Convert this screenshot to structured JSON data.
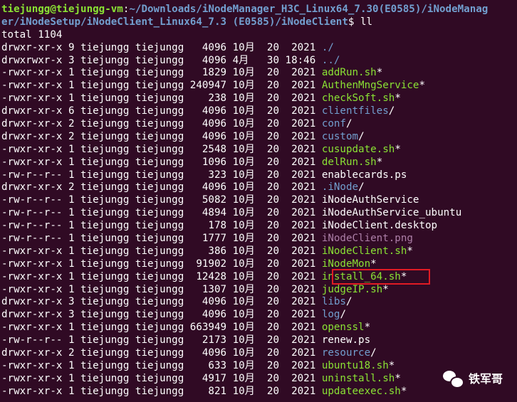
{
  "prompt": {
    "user_host": "tiejungg@tiejungg-vm",
    "separator": ":",
    "path_line1": "~/Downloads/iNodeManager_H3C_Linux64_7.30(E0585)/iNodeManag",
    "path_line2": "er/iNodeSetup/iNodeClient_Linux64_7.3 (E0585)/iNodeClient",
    "symbol": "$ ",
    "command": "ll"
  },
  "total": "total 1104",
  "entries": [
    {
      "meta": "drwxr-xr-x 9 tiejungg tiejungg   4096 10月  20  2021 ",
      "name": "./",
      "cls": "dir",
      "suffix": ""
    },
    {
      "meta": "drwxrwxr-x 3 tiejungg tiejungg   4096 4月   30 18:46 ",
      "name": "../",
      "cls": "dir",
      "suffix": ""
    },
    {
      "meta": "-rwxr-xr-x 1 tiejungg tiejungg   1829 10月  20  2021 ",
      "name": "addRun.sh",
      "cls": "exe",
      "suffix": "*"
    },
    {
      "meta": "-rwxr-xr-x 1 tiejungg tiejungg 240947 10月  20  2021 ",
      "name": "AuthenMngService",
      "cls": "exe",
      "suffix": "*"
    },
    {
      "meta": "-rwxr-xr-x 1 tiejungg tiejungg    238 10月  20  2021 ",
      "name": "checkSoft.sh",
      "cls": "exe",
      "suffix": "*"
    },
    {
      "meta": "drwxr-xr-x 6 tiejungg tiejungg   4096 10月  20  2021 ",
      "name": "clientfiles",
      "cls": "dir",
      "suffix": "/"
    },
    {
      "meta": "drwxr-xr-x 2 tiejungg tiejungg   4096 10月  20  2021 ",
      "name": "conf",
      "cls": "dir",
      "suffix": "/"
    },
    {
      "meta": "drwxr-xr-x 2 tiejungg tiejungg   4096 10月  20  2021 ",
      "name": "custom",
      "cls": "dir",
      "suffix": "/"
    },
    {
      "meta": "-rwxr-xr-x 1 tiejungg tiejungg   2548 10月  20  2021 ",
      "name": "cusupdate.sh",
      "cls": "exe",
      "suffix": "*"
    },
    {
      "meta": "-rwxr-xr-x 1 tiejungg tiejungg   1096 10月  20  2021 ",
      "name": "delRun.sh",
      "cls": "exe",
      "suffix": "*"
    },
    {
      "meta": "-rw-r--r-- 1 tiejungg tiejungg    323 10月  20  2021 ",
      "name": "enablecards.ps",
      "cls": "plain",
      "suffix": ""
    },
    {
      "meta": "drwxr-xr-x 2 tiejungg tiejungg   4096 10月  20  2021 ",
      "name": ".iNode",
      "cls": "dir",
      "suffix": "/"
    },
    {
      "meta": "-rw-r--r-- 1 tiejungg tiejungg   5082 10月  20  2021 ",
      "name": "iNodeAuthService",
      "cls": "plain",
      "suffix": ""
    },
    {
      "meta": "-rw-r--r-- 1 tiejungg tiejungg   4894 10月  20  2021 ",
      "name": "iNodeAuthService_ubuntu",
      "cls": "plain",
      "suffix": ""
    },
    {
      "meta": "-rw-r--r-- 1 tiejungg tiejungg    178 10月  20  2021 ",
      "name": "iNodeClient.desktop",
      "cls": "plain",
      "suffix": ""
    },
    {
      "meta": "-rw-r--r-- 1 tiejungg tiejungg   1777 10月  20  2021 ",
      "name": "iNodeClient.png",
      "cls": "img",
      "suffix": ""
    },
    {
      "meta": "-rwxr-xr-x 1 tiejungg tiejungg    386 10月  20  2021 ",
      "name": "iNodeClient.sh",
      "cls": "exe",
      "suffix": "*"
    },
    {
      "meta": "-rwxr-xr-x 1 tiejungg tiejungg  91902 10月  20  2021 ",
      "name": "iNodeMon",
      "cls": "exe",
      "suffix": "*"
    },
    {
      "meta": "-rwxr-xr-x 1 tiejungg tiejungg  12428 10月  20  2021 ",
      "name": "install_64.sh",
      "cls": "exe",
      "suffix": "*"
    },
    {
      "meta": "-rwxr-xr-x 1 tiejungg tiejungg   1307 10月  20  2021 ",
      "name": "judgeIP.sh",
      "cls": "exe",
      "suffix": "*"
    },
    {
      "meta": "drwxr-xr-x 3 tiejungg tiejungg   4096 10月  20  2021 ",
      "name": "libs",
      "cls": "dir",
      "suffix": "/"
    },
    {
      "meta": "drwxr-xr-x 3 tiejungg tiejungg   4096 10月  20  2021 ",
      "name": "log",
      "cls": "dir",
      "suffix": "/"
    },
    {
      "meta": "-rwxr-xr-x 1 tiejungg tiejungg 663949 10月  20  2021 ",
      "name": "openssl",
      "cls": "exe",
      "suffix": "*"
    },
    {
      "meta": "-rw-r--r-- 1 tiejungg tiejungg   2173 10月  20  2021 ",
      "name": "renew.ps",
      "cls": "plain",
      "suffix": ""
    },
    {
      "meta": "drwxr-xr-x 2 tiejungg tiejungg   4096 10月  20  2021 ",
      "name": "resource",
      "cls": "dir",
      "suffix": "/"
    },
    {
      "meta": "-rwxr-xr-x 1 tiejungg tiejungg    633 10月  20  2021 ",
      "name": "ubuntu18.sh",
      "cls": "exe",
      "suffix": "*"
    },
    {
      "meta": "-rwxr-xr-x 1 tiejungg tiejungg   4917 10月  20  2021 ",
      "name": "uninstall.sh",
      "cls": "exe",
      "suffix": "*"
    },
    {
      "meta": "-rwxr-xr-x 1 tiejungg tiejungg    821 10月  20  2021 ",
      "name": "updateexec.sh",
      "cls": "exe",
      "suffix": "*"
    }
  ],
  "highlighted_entry": "install_64.sh",
  "watermark": {
    "icon": "wechat-icon",
    "text": "铁军哥"
  },
  "colors": {
    "background": "#300a24",
    "user_host": "#8ae234",
    "path": "#729fcf",
    "directory": "#729fcf",
    "executable": "#8ae234",
    "image": "#ad7fa8",
    "highlight": "#e01b24"
  }
}
